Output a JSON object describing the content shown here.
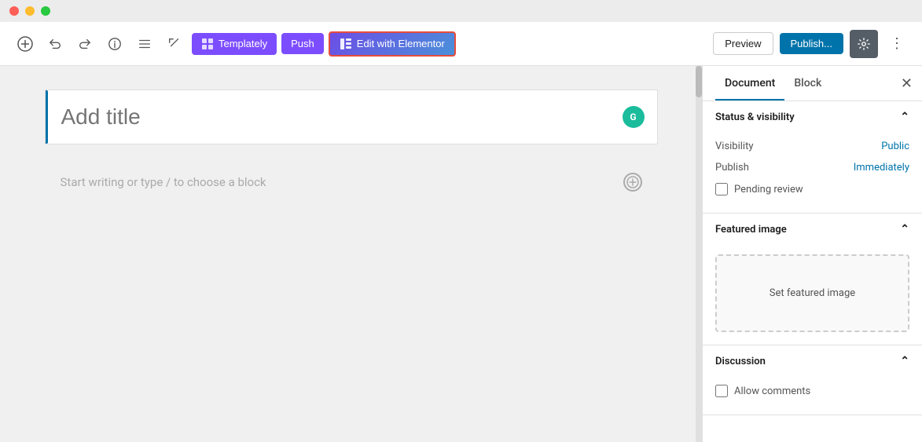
{
  "titleBar": {
    "trafficLights": [
      "red",
      "yellow",
      "green"
    ]
  },
  "toolbar": {
    "undoLabel": "↩",
    "redoLabel": "↪",
    "infoLabel": "ℹ",
    "listLabel": "≡",
    "editLabel": "✎",
    "templatlyLabel": "Templately",
    "pushLabel": "Push",
    "elementorLabel": "Edit with Elementor",
    "previewLabel": "Preview",
    "publishLabel": "Publish...",
    "settingsLabel": "⚙",
    "moreLabel": "⋮"
  },
  "editor": {
    "titlePlaceholder": "Add title",
    "contentPlaceholder": "Start writing or type / to choose a block",
    "avatarInitial": "G"
  },
  "sidebar": {
    "tabs": [
      {
        "label": "Document",
        "active": true
      },
      {
        "label": "Block",
        "active": false
      }
    ],
    "closeLabel": "✕",
    "sections": [
      {
        "id": "status-visibility",
        "title": "Status & visibility",
        "expanded": true,
        "rows": [
          {
            "label": "Visibility",
            "value": "Public"
          },
          {
            "label": "Publish",
            "value": "Immediately"
          }
        ],
        "checkboxes": [
          {
            "label": "Pending review",
            "checked": false
          }
        ]
      },
      {
        "id": "featured-image",
        "title": "Featured image",
        "expanded": true,
        "setImageLabel": "Set featured image"
      },
      {
        "id": "discussion",
        "title": "Discussion",
        "expanded": true,
        "checkboxes": [
          {
            "label": "Allow comments",
            "checked": false
          }
        ]
      }
    ]
  }
}
